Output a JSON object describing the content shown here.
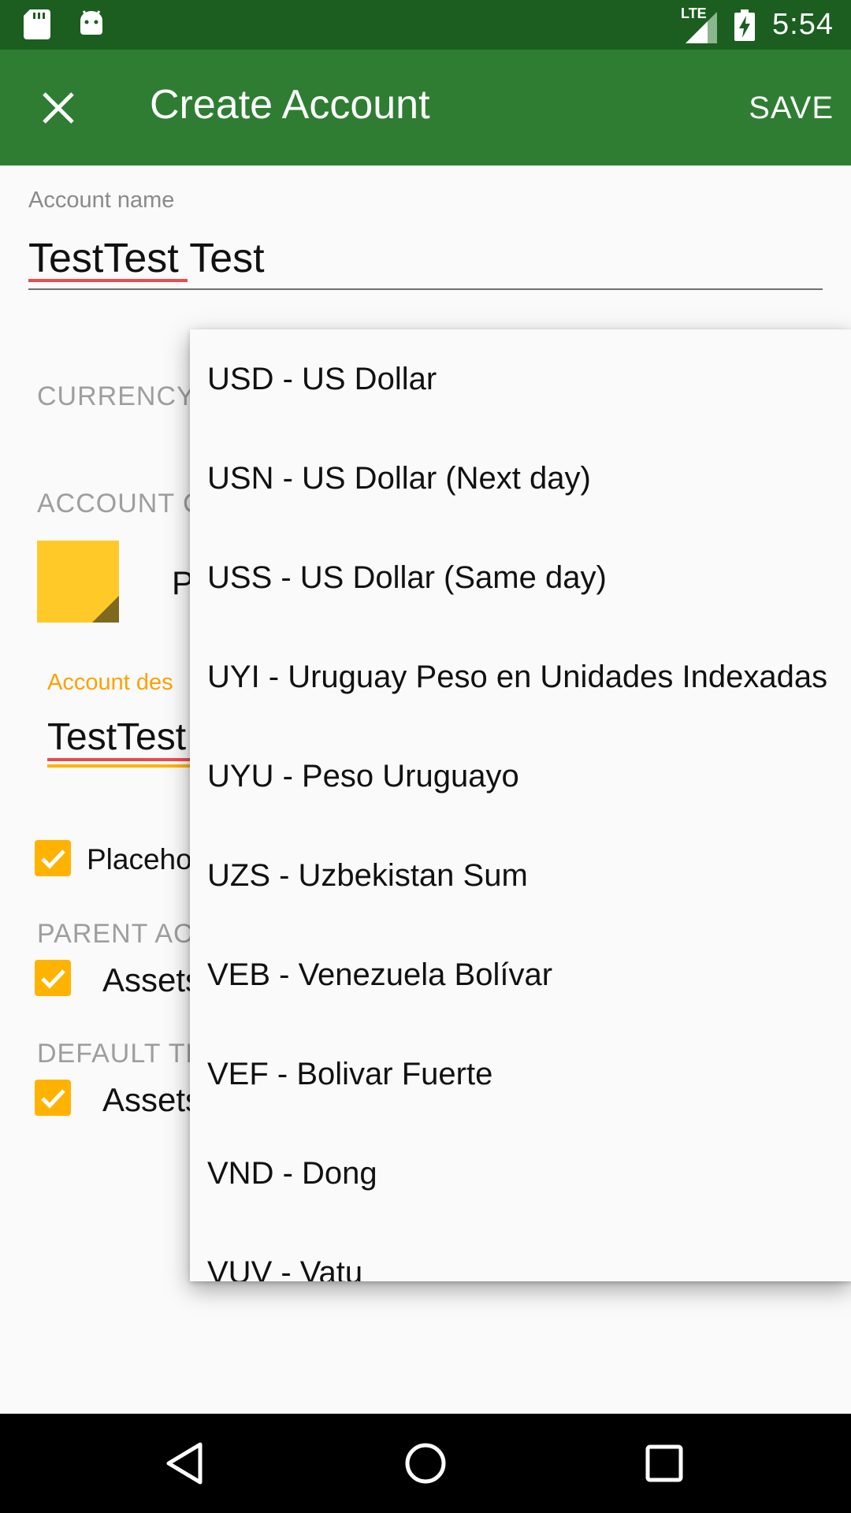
{
  "status_bar": {
    "time": "5:54",
    "network": "LTE",
    "icons": [
      "sd-card-icon",
      "android-icon",
      "signal-icon",
      "battery-charging-icon"
    ]
  },
  "app_bar": {
    "title": "Create Account",
    "save_label": "SAVE",
    "close_icon": "close-icon"
  },
  "form": {
    "account_name_label": "Account name",
    "account_name_value": "TestTest Test",
    "currency_label": "CURRENCY",
    "account_color_label": "ACCOUNT C",
    "color_partial_text": "P",
    "color": "#ffca28",
    "description_label": "Account des",
    "description_value": "TestTest",
    "placeholder_label": "Placeho",
    "parent_section_label": "PARENT AC",
    "parent_value": "Assets",
    "default_section_label": "DEFAULT TR",
    "default_value": "Assets"
  },
  "currency_dropdown": {
    "options": [
      "USD - US Dollar",
      "USN - US Dollar (Next day)",
      "USS - US Dollar (Same day)",
      "UYI - Uruguay Peso en Unidades Indexadas",
      "UYU - Peso Uruguayo",
      "UZS - Uzbekistan Sum",
      "VEB - Venezuela Bolívar",
      "VEF - Bolivar Fuerte",
      "VND - Dong",
      "VUV - Vatu"
    ]
  },
  "nav_bar": {
    "icons": [
      "back-icon",
      "home-icon",
      "recents-icon"
    ]
  },
  "colors": {
    "status_bar": "#1b5e20",
    "app_bar": "#2e7d32",
    "accent": "#ffb300"
  }
}
